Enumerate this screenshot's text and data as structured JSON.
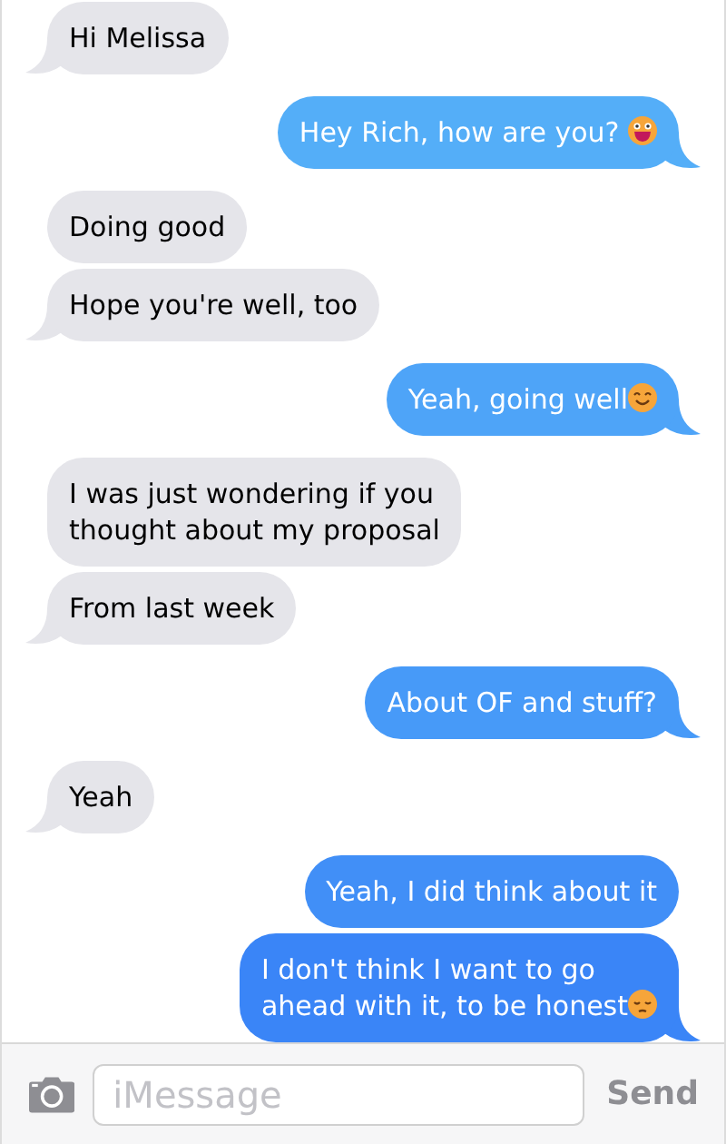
{
  "messages": [
    {
      "kind": "incoming",
      "text": "Hi Melissa",
      "tail": true
    },
    {
      "kind": "outgoing",
      "text": "Hey Rich, how are you? ",
      "tail": true,
      "emoji": true
    },
    {
      "kind": "incoming",
      "text": "Doing good",
      "tail": false
    },
    {
      "kind": "incoming",
      "text": "Hope you're well, too",
      "tail": true
    },
    {
      "kind": "outgoing",
      "text": "Yeah, going well",
      "tail": true,
      "emoji": true
    },
    {
      "kind": "incoming",
      "text": "I was just wondering if you\nthought about my proposal",
      "tail": false
    },
    {
      "kind": "incoming",
      "text": "From last week",
      "tail": true
    },
    {
      "kind": "outgoing",
      "text": "About OF and stuff?",
      "tail": true
    },
    {
      "kind": "incoming",
      "text": "Yeah",
      "tail": true
    },
    {
      "kind": "outgoing",
      "text": "Yeah, I did think about it",
      "tail": false
    },
    {
      "kind": "outgoing",
      "text": "I don't think I want to go\nahead with it, to be honest",
      "tail": true,
      "emoji": true
    }
  ],
  "composer": {
    "placeholder": "iMessage",
    "send": "Send"
  }
}
